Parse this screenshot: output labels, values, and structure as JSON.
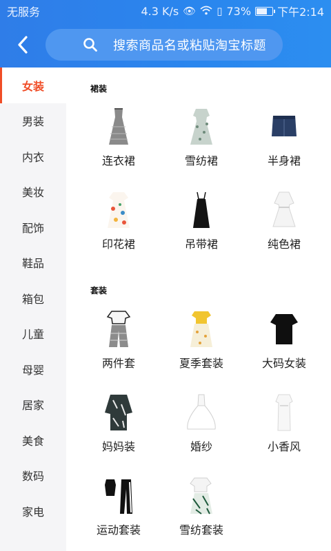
{
  "status": {
    "carrier": "无服务",
    "speed": "4.3 K/s",
    "battery": "73%",
    "battery_level": 0.73,
    "time": "下午2:14"
  },
  "header": {
    "search_placeholder": "搜索商品名或粘贴淘宝标题",
    "color": "#2a86ee"
  },
  "sidebar": {
    "items": [
      {
        "label": "女装",
        "active": true
      },
      {
        "label": "男装"
      },
      {
        "label": "内衣"
      },
      {
        "label": "美妆"
      },
      {
        "label": "配饰"
      },
      {
        "label": "鞋品"
      },
      {
        "label": "箱包"
      },
      {
        "label": "儿童"
      },
      {
        "label": "母婴"
      },
      {
        "label": "居家"
      },
      {
        "label": "美食"
      },
      {
        "label": "数码"
      },
      {
        "label": "家电"
      }
    ],
    "active_color": "#f04d27"
  },
  "sections": [
    {
      "title": "裙装",
      "items": [
        {
          "label": "连衣裙",
          "icon": "dress-gray-icon"
        },
        {
          "label": "雪纺裙",
          "icon": "chiffon-dress-icon"
        },
        {
          "label": "半身裙",
          "icon": "denim-skirt-icon"
        },
        {
          "label": "印花裙",
          "icon": "print-dress-icon"
        },
        {
          "label": "吊带裙",
          "icon": "slip-dress-icon"
        },
        {
          "label": "纯色裙",
          "icon": "white-dress-icon"
        }
      ]
    },
    {
      "title": "套装",
      "items": [
        {
          "label": "两件套",
          "icon": "two-piece-icon"
        },
        {
          "label": "夏季套装",
          "icon": "summer-set-icon"
        },
        {
          "label": "大码女装",
          "icon": "plus-size-tee-icon"
        },
        {
          "label": "妈妈装",
          "icon": "mom-wear-icon"
        },
        {
          "label": "婚纱",
          "icon": "wedding-dress-icon"
        },
        {
          "label": "小香风",
          "icon": "chanel-style-icon"
        },
        {
          "label": "运动套装",
          "icon": "sport-set-icon"
        },
        {
          "label": "雪纺套装",
          "icon": "chiffon-set-icon"
        }
      ]
    }
  ]
}
